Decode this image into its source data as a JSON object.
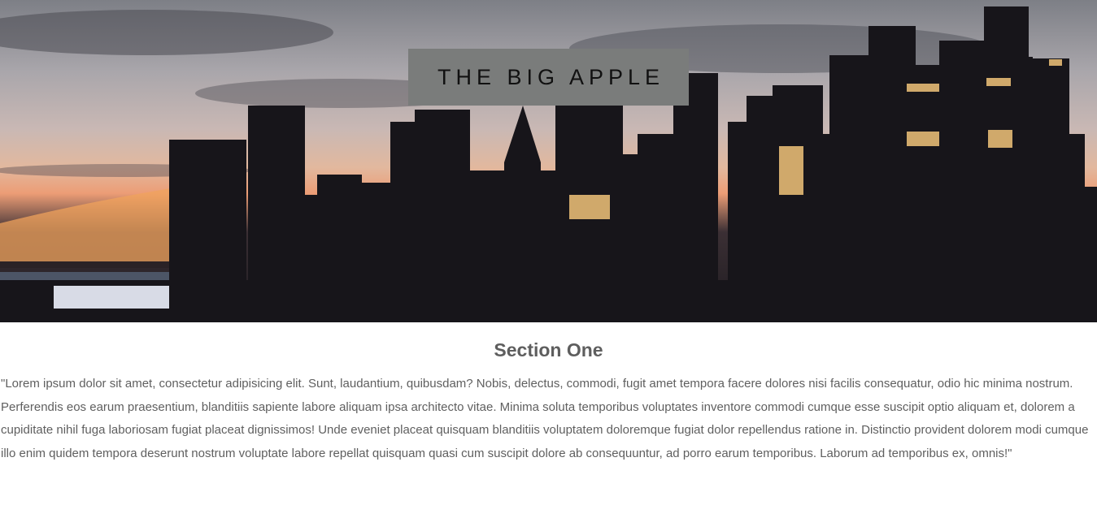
{
  "hero": {
    "title": "THE BIG APPLE",
    "background_description_colors": {
      "sky_top": "#7d7f86",
      "sunset": "#ec9d76",
      "buildings": "#1c1a1f",
      "title_box": "#7a7c7b"
    }
  },
  "section": {
    "heading": "Section One",
    "body": "\"Lorem ipsum dolor sit amet, consectetur adipisicing elit. Sunt, laudantium, quibusdam? Nobis, delectus, commodi, fugit amet tempora facere dolores nisi facilis consequatur, odio hic minima nostrum. Perferendis eos earum praesentium, blanditiis sapiente labore aliquam ipsa architecto vitae. Minima soluta temporibus voluptates inventore commodi cumque esse suscipit optio aliquam et, dolorem a cupiditate nihil fuga laboriosam fugiat placeat dignissimos! Unde eveniet placeat quisquam blanditiis voluptatem doloremque fugiat dolor repellendus ratione in. Distinctio provident dolorem modi cumque illo enim quidem tempora deserunt nostrum voluptate labore repellat quisquam quasi cum suscipit dolore ab consequuntur, ad porro earum temporibus. Laborum ad temporibus ex, omnis!\""
  }
}
